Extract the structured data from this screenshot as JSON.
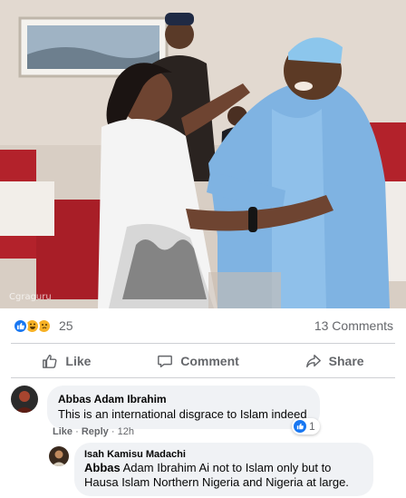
{
  "post": {
    "photo_caption": "",
    "reactions": {
      "count": "25",
      "types": [
        "like-icon",
        "haha-icon",
        "sad-icon"
      ]
    },
    "comments_count": "13 Comments"
  },
  "actions": {
    "like_label": "Like",
    "comment_label": "Comment",
    "share_label": "Share"
  },
  "comments": [
    {
      "author": "Abbas Adam Ibrahim",
      "text": "This is an international disgrace to Islam indeed",
      "like_action": "Like",
      "reply_action": "Reply",
      "time": "12h",
      "reaction_count": "1"
    }
  ],
  "reply": {
    "author": "Isah Kamisu Madachi",
    "mention": "Abbas",
    "text_after_mention": " Adam Ibrahim Ai not to Islam only but to Hausa Islam Northern Nigeria and Nigeria at large."
  },
  "colors": {
    "accent": "#1877f2",
    "secondary_text": "#65676b",
    "bubble": "#f0f2f5"
  }
}
